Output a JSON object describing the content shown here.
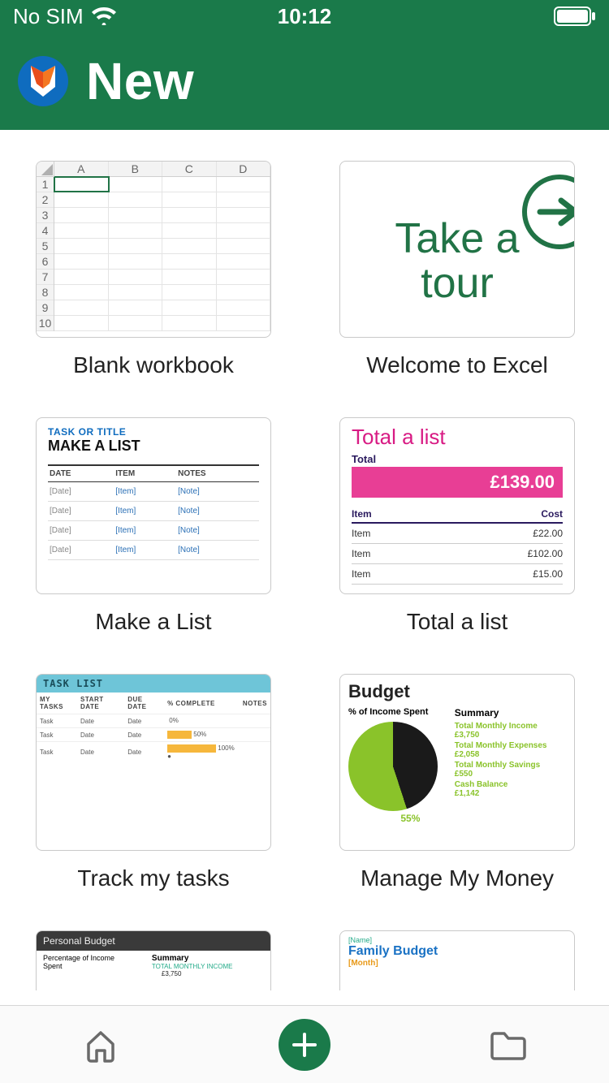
{
  "status": {
    "carrier": "No SIM",
    "time": "10:12"
  },
  "header": {
    "title": "New"
  },
  "templates": [
    {
      "label": "Blank workbook"
    },
    {
      "label": "Welcome to Excel",
      "tour_text": "Take a\ntour"
    },
    {
      "label": "Make a List",
      "preview": {
        "subtitle": "TASK OR TITLE",
        "title": "MAKE A LIST",
        "columns": [
          "DATE",
          "ITEM",
          "NOTES"
        ],
        "rows": [
          [
            "[Date]",
            "[Item]",
            "[Note]"
          ],
          [
            "[Date]",
            "[Item]",
            "[Note]"
          ],
          [
            "[Date]",
            "[Item]",
            "[Note]"
          ],
          [
            "[Date]",
            "[Item]",
            "[Note]"
          ]
        ]
      }
    },
    {
      "label": "Total a list",
      "preview": {
        "title": "Total a list",
        "total_label": "Total",
        "total_value": "£139.00",
        "columns": [
          "Item",
          "Cost"
        ],
        "rows": [
          [
            "Item",
            "£22.00"
          ],
          [
            "Item",
            "£102.00"
          ],
          [
            "Item",
            "£15.00"
          ]
        ]
      }
    },
    {
      "label": "Track my tasks",
      "preview": {
        "heading": "TASK LIST",
        "columns": [
          "MY TASKS",
          "START DATE",
          "DUE DATE",
          "% COMPLETE",
          "NOTES"
        ],
        "rows": [
          {
            "task": "Task",
            "start": "Date",
            "due": "Date",
            "pct": 0
          },
          {
            "task": "Task",
            "start": "Date",
            "due": "Date",
            "pct": 50
          },
          {
            "task": "Task",
            "start": "Date",
            "due": "Date",
            "pct": 100
          }
        ]
      }
    },
    {
      "label": "Manage My Money",
      "preview": {
        "title": "Budget",
        "left_label": "% of Income Spent",
        "percent": "55%",
        "right_label": "Summary",
        "summary": [
          {
            "k": "Total Monthly Income",
            "v": "£3,750"
          },
          {
            "k": "Total Monthly Expenses",
            "v": "£2,058"
          },
          {
            "k": "Total Monthly Savings",
            "v": "£550"
          },
          {
            "k": "Cash Balance",
            "v": "£1,142"
          }
        ]
      }
    },
    {
      "label": "",
      "preview": {
        "bar": "Personal Budget",
        "left": "Percentage of Income Spent",
        "right": "Summary",
        "income_label": "TOTAL MONTHLY INCOME",
        "income_value": "£3,750"
      }
    },
    {
      "label": "",
      "preview": {
        "name": "[Name]",
        "title": "Family Budget",
        "month": "[Month]"
      }
    }
  ],
  "tabs": {
    "home": "Home",
    "new": "New",
    "open": "Open"
  }
}
